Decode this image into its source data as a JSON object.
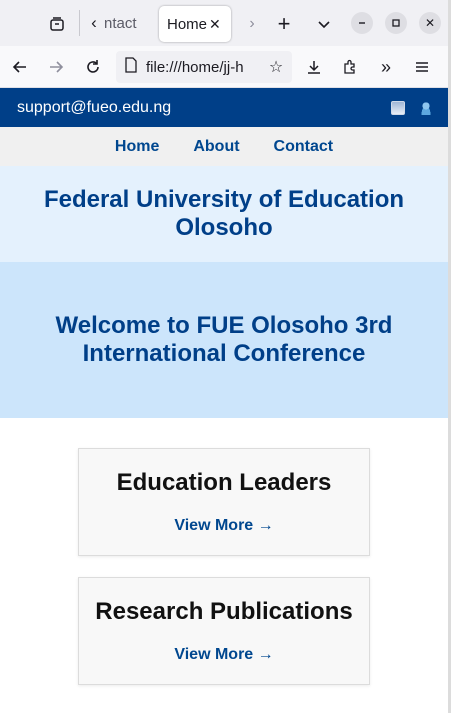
{
  "browser": {
    "prev_tab_label": "ntact",
    "active_tab_label": "Home",
    "url": "file:///home/jj-h",
    "icons": {
      "list_all_tabs": "tab-list-icon",
      "scroll_left": "chevron-left-icon",
      "close_tab": "close-icon",
      "scroll_right": "chevron-right-icon",
      "new_tab": "plus-icon",
      "tab_menu": "chevron-down-icon",
      "minimize": "minimize-icon",
      "maximize": "maximize-icon",
      "close_window": "close-icon",
      "back": "back-arrow-icon",
      "forward": "forward-arrow-icon",
      "reload": "reload-icon",
      "page": "page-icon",
      "bookmark": "star-icon",
      "downloads": "download-icon",
      "extensions": "puzzle-icon",
      "overflow": "double-chevron-icon",
      "menu": "hamburger-icon"
    }
  },
  "site": {
    "topbar": {
      "email": "support@fueo.edu.ng",
      "icons": [
        "book-icon",
        "user-icon"
      ]
    },
    "nav": [
      "Home",
      "About",
      "Contact"
    ],
    "header_title": "Federal University of Education Olosoho",
    "hero_title": "Welcome to FUE Olosoho 3rd International Conference",
    "cards": [
      {
        "title": "Education Leaders",
        "link": "View More →"
      },
      {
        "title": "Research Publications",
        "link": "View More →"
      }
    ]
  },
  "colors": {
    "brand_blue": "#003f88",
    "header_band": "#e4f1fd",
    "hero_band": "#cce5fb"
  }
}
